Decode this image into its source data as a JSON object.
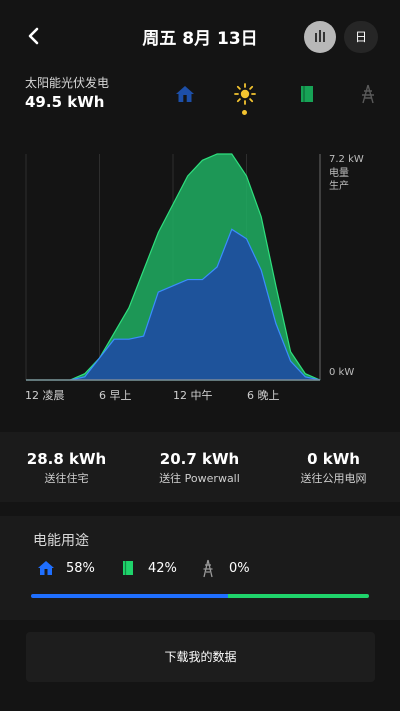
{
  "header": {
    "title": "周五 8月 13日",
    "day_button": "日"
  },
  "summary": {
    "label": "太阳能光伏发电",
    "value": "49.5 kWh",
    "sources": [
      "home-icon",
      "sun-icon",
      "powerwall-icon",
      "grid-tower-icon"
    ],
    "selected": "sun-icon"
  },
  "chart_data": {
    "type": "area",
    "x": [
      "12 凌晨",
      "6 早上",
      "12 中午",
      "6 晚上"
    ],
    "y_top_label": "7.2 kW",
    "y_top_caption": "电量\n生产",
    "y_bottom_label": "0 kW",
    "ylim": [
      0,
      7.2
    ],
    "series": [
      {
        "color": "#1fae62",
        "values": [
          0,
          0,
          0,
          0,
          0.2,
          0.7,
          1.5,
          2.3,
          3.5,
          4.7,
          5.6,
          6.5,
          7.0,
          7.2,
          7.2,
          6.5,
          5.2,
          3.0,
          0.9,
          0.2,
          0
        ]
      },
      {
        "color": "#1f4f9f",
        "values": [
          0,
          0,
          0,
          0,
          0.1,
          0.7,
          1.3,
          1.3,
          1.4,
          2.8,
          3.0,
          3.2,
          3.2,
          3.6,
          4.8,
          4.5,
          3.5,
          1.8,
          0.6,
          0.1,
          0
        ]
      }
    ],
    "x_range_hours": [
      0,
      24
    ]
  },
  "stats": [
    {
      "value": "28.8 kWh",
      "label": "送往住宅"
    },
    {
      "value": "20.7 kWh",
      "label": "送往 Powerwall"
    },
    {
      "value": "0 kWh",
      "label": "送往公用电网"
    }
  ],
  "usage": {
    "title": "电能用途",
    "home_pct": "58%",
    "powerwall_pct": "42%",
    "grid_pct": "0%",
    "home_fraction": 0.58,
    "powerwall_fraction": 0.42,
    "colors": {
      "home": "#1f6fff",
      "powerwall": "#1fd36b"
    }
  },
  "download_label": "下载我的数据"
}
